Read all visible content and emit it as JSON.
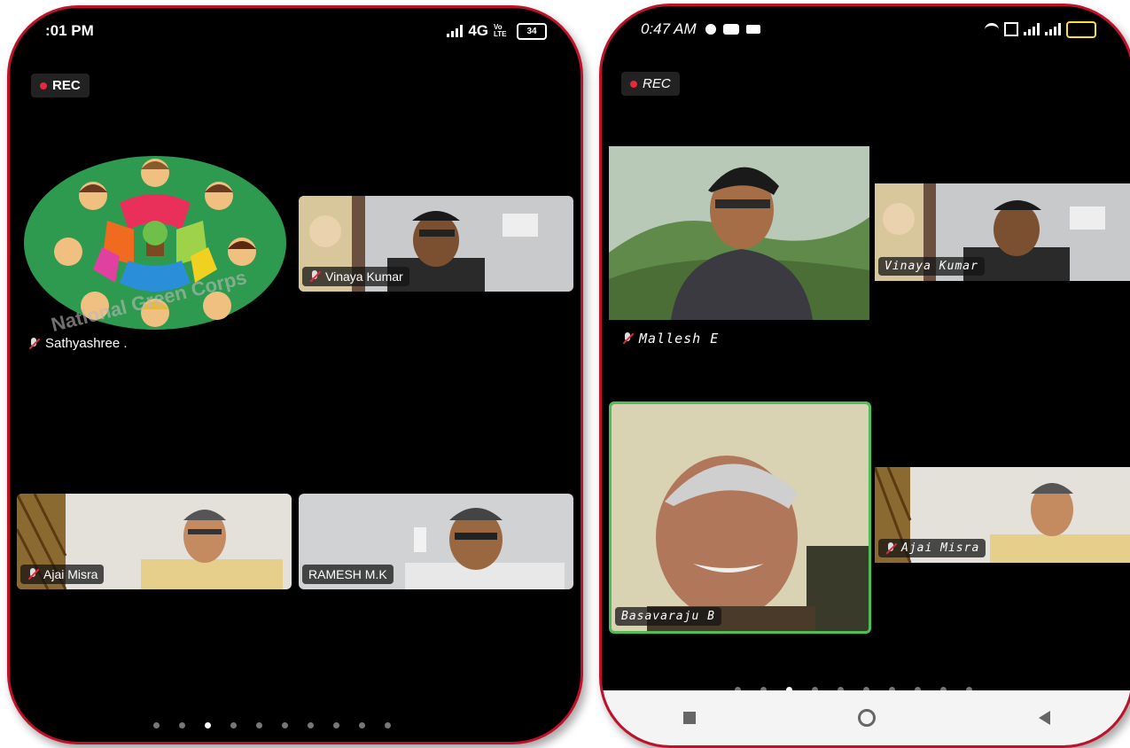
{
  "left": {
    "status_time": ":01 PM",
    "status_net": "4G",
    "status_lte": "Vo LTE",
    "battery": "34",
    "rec_label": "REC",
    "logo_text_bottom": "National Green Corps",
    "logo_name": "Sathyashree .",
    "participants": [
      "Vinaya Kumar",
      "Ajai Misra",
      "RAMESH M.K"
    ],
    "page_dots": 10,
    "active_dot": 2
  },
  "right": {
    "status_time": "0:47 AM",
    "rec_label": "REC",
    "participants": [
      "Mallesh E",
      "Vinaya Kumar",
      "Basavaraju B",
      "Ajai Misra"
    ],
    "page_dots": 10,
    "active_dot": 2
  },
  "colors": {
    "frame": "#c0102a",
    "rec_dot": "#e8283c",
    "active_speaker": "#4cbf55",
    "logo_green": "#2e9a4f"
  }
}
